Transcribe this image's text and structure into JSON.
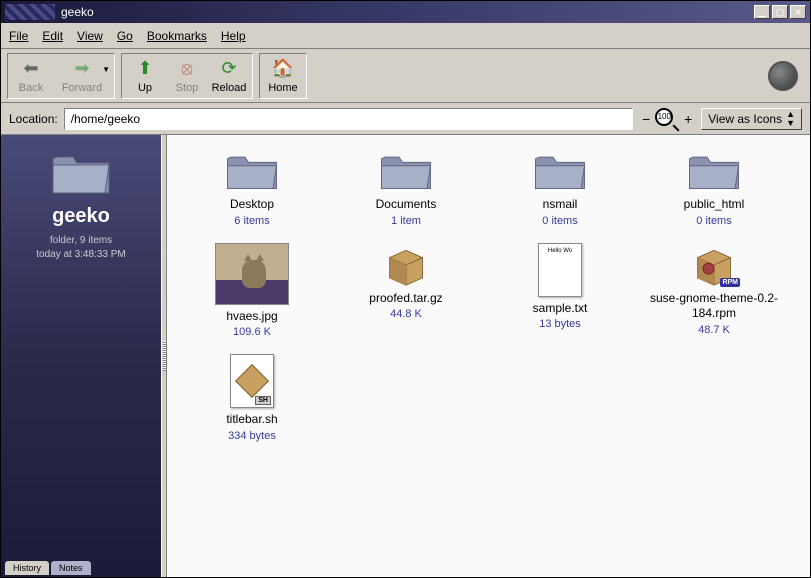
{
  "window": {
    "title": "geeko"
  },
  "menu": [
    "File",
    "Edit",
    "View",
    "Go",
    "Bookmarks",
    "Help"
  ],
  "toolbar": {
    "back": "Back",
    "forward": "Forward",
    "up": "Up",
    "stop": "Stop",
    "reload": "Reload",
    "home": "Home"
  },
  "location": {
    "label": "Location:",
    "value": "/home/geeko",
    "zoom": "100",
    "view_as": "View as Icons"
  },
  "sidebar": {
    "title": "geeko",
    "line1": "folder, 9 items",
    "line2": "today at 3:48:33 PM",
    "tabs": [
      "History",
      "Notes"
    ]
  },
  "files": [
    {
      "name": "Desktop",
      "meta": "6 items",
      "type": "folder"
    },
    {
      "name": "Documents",
      "meta": "1 item",
      "type": "folder"
    },
    {
      "name": "nsmail",
      "meta": "0 items",
      "type": "folder"
    },
    {
      "name": "public_html",
      "meta": "0 items",
      "type": "folder"
    },
    {
      "name": "hvaes.jpg",
      "meta": "109.6 K",
      "type": "image"
    },
    {
      "name": "proofed.tar.gz",
      "meta": "44.8 K",
      "type": "archive"
    },
    {
      "name": "sample.txt",
      "meta": "13 bytes",
      "type": "text",
      "preview": "Hello Wo"
    },
    {
      "name": "suse-gnome-theme-0.2-184.rpm",
      "meta": "48.7 K",
      "type": "rpm"
    },
    {
      "name": "titlebar.sh",
      "meta": "334 bytes",
      "type": "sh"
    }
  ]
}
